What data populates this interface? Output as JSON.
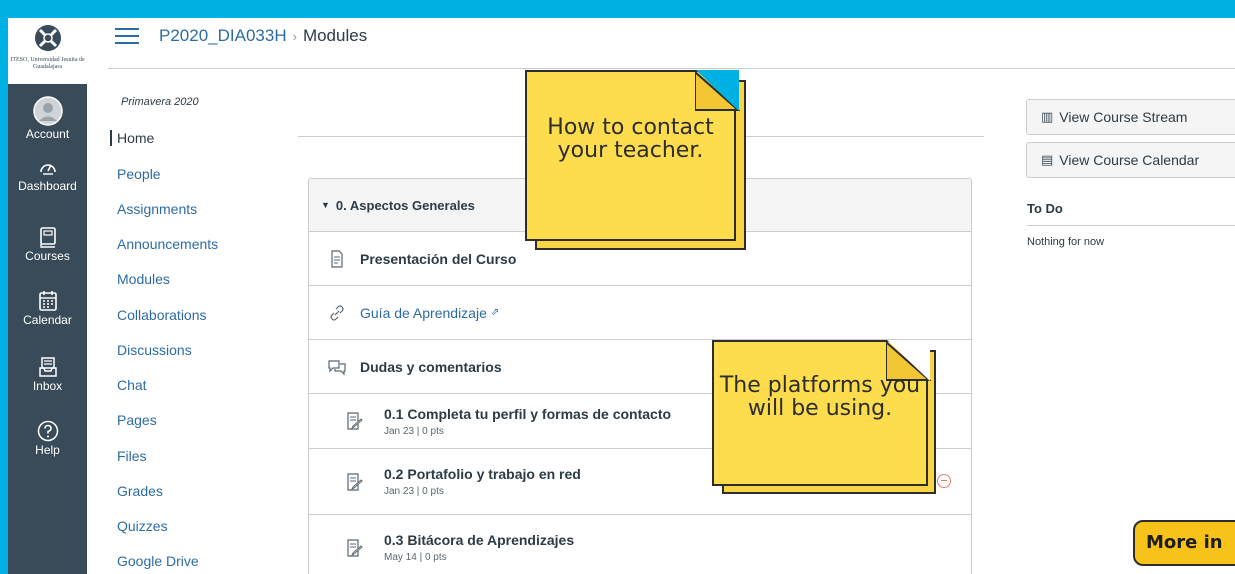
{
  "header": {
    "course_code": "P2020_DIA033H",
    "separator": "›",
    "current_page": "Modules"
  },
  "global_nav": {
    "logo_text": "ITESO, Universidad Jesuita de Guadalajara",
    "items": [
      {
        "label": "Account",
        "icon": "account-avatar-icon"
      },
      {
        "label": "Dashboard",
        "icon": "dashboard-gauge-icon"
      },
      {
        "label": "Courses",
        "icon": "courses-book-icon"
      },
      {
        "label": "Calendar",
        "icon": "calendar-icon"
      },
      {
        "label": "Inbox",
        "icon": "inbox-icon"
      },
      {
        "label": "Help",
        "icon": "help-question-icon"
      }
    ]
  },
  "course_nav": {
    "term": "Primavera 2020",
    "items": [
      {
        "label": "Home"
      },
      {
        "label": "People"
      },
      {
        "label": "Assignments"
      },
      {
        "label": "Announcements"
      },
      {
        "label": "Modules"
      },
      {
        "label": "Collaborations"
      },
      {
        "label": "Discussions"
      },
      {
        "label": "Chat"
      },
      {
        "label": "Pages"
      },
      {
        "label": "Files"
      },
      {
        "label": "Grades"
      },
      {
        "label": "Quizzes"
      },
      {
        "label": "Google Drive"
      }
    ]
  },
  "module": {
    "title": "0. Aspectos Generales",
    "items": [
      {
        "title": "Presentación del Curso",
        "icon": "page-icon"
      },
      {
        "title": "Guía de Aprendizaje",
        "icon": "link-icon"
      },
      {
        "title": "Dudas y comentarios",
        "icon": "discussion-icon"
      },
      {
        "title": "0.1 Completa tu perfil y formas de contacto",
        "meta": "Jan 23 | 0 pts",
        "icon": "assignment-icon"
      },
      {
        "title": "0.2 Portafolio y trabajo en red",
        "meta": "Jan 23 | 0 pts",
        "icon": "assignment-icon"
      },
      {
        "title": "0.3 Bitácora de Aprendizajes",
        "meta": "May 14 | 0 pts",
        "icon": "assignment-icon"
      }
    ]
  },
  "sidebar": {
    "stream_button": "View Course Stream",
    "calendar_button": "View Course Calendar",
    "todo_heading": "To Do",
    "todo_empty": "Nothing for now"
  },
  "annotations": {
    "note1": "How to contact your teacher.",
    "note2": "The platforms you will be using.",
    "more_button": "More in"
  },
  "colors": {
    "background": "#00b1e4",
    "nav_dark": "#394b58",
    "link": "#2d6ca2",
    "note_yellow": "#fddc4e",
    "button_yellow": "#f7c21a"
  }
}
